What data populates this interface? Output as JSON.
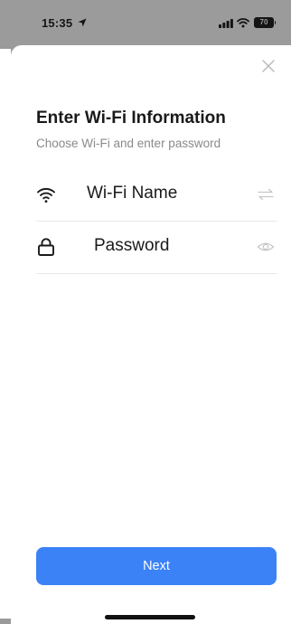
{
  "status_bar": {
    "time": "15:35",
    "battery": "70",
    "icons": [
      "location-arrow-icon",
      "cellular-signal-icon",
      "wifi-icon",
      "battery-icon"
    ]
  },
  "dialog": {
    "title": "Enter Wi-Fi Information",
    "subtitle": "Choose Wi-Fi and enter password",
    "close_icon": "close-icon"
  },
  "fields": {
    "wifi": {
      "value": "Wi-Fi Name",
      "icon": "wifi-icon",
      "action_icon": "switch-arrows-icon"
    },
    "password": {
      "value": "Password",
      "icon": "lock-icon",
      "action_icon": "eye-icon"
    }
  },
  "actions": {
    "next_label": "Next"
  },
  "colors": {
    "accent": "#3b82f6",
    "status_bar_bg": "#9b9b9b",
    "sheet_bg": "#ffffff",
    "title_text": "#1a1a1a",
    "subtitle_text": "#8a8a8a",
    "divider": "#e8e8e8",
    "muted_icon": "#c7c7c7"
  }
}
